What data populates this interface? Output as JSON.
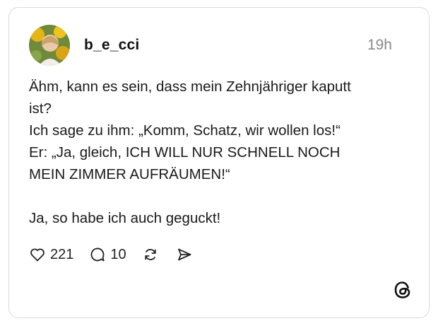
{
  "post": {
    "username": "b_e_cci",
    "timestamp": "19h",
    "text_lines": [
      "Ähm, kann es sein, dass mein Zehnjähriger kaputt",
      "ist?",
      "Ich sage zu ihm: „Komm, Schatz, wir wollen los!“",
      "Er: „Ja, gleich, ICH WILL NUR SCHNELL NOCH",
      "MEIN ZIMMER AUFRÄUMEN!“",
      "",
      "Ja, so habe ich auch geguckt!"
    ]
  },
  "actions": {
    "likes": "221",
    "replies": "10"
  },
  "icons": {
    "like": "heart-icon",
    "reply": "comment-icon",
    "repost": "repost-icon",
    "share": "send-icon",
    "brand": "threads-logo-icon"
  }
}
